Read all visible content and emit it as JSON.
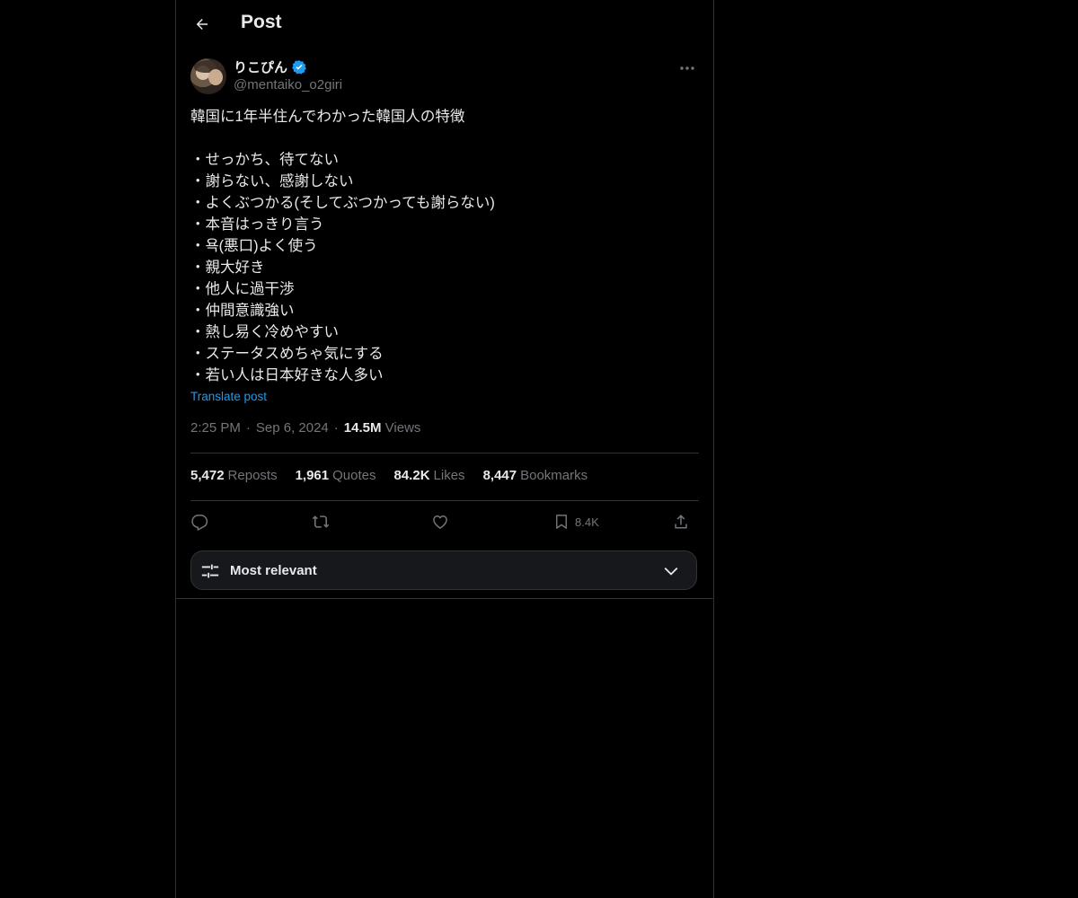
{
  "header": {
    "title": "Post"
  },
  "author": {
    "display_name": "りこぴん",
    "handle": "@mentaiko_o2giri"
  },
  "post": {
    "text": "韓国に1年半住んでわかった韓国人の特徴\n\n・せっかち、待てない\n・謝らない、感謝しない\n・よくぶつかる(そしてぶつかっても謝らない)\n・本音はっきり言う\n・욕(悪口)よく使う\n・親大好き\n・他人に過干渉\n・仲間意識強い\n・熱し易く冷めやすい\n・ステータスめちゃ気にする\n・若い人は日本好きな人多い",
    "translate_label": "Translate post",
    "time": "2:25 PM",
    "date": "Sep 6, 2024",
    "separator": "·",
    "views_count": "14.5M",
    "views_label": "Views"
  },
  "stats": [
    {
      "count": "5,472",
      "label": "Reposts"
    },
    {
      "count": "1,961",
      "label": "Quotes"
    },
    {
      "count": "84.2K",
      "label": "Likes"
    },
    {
      "count": "8,447",
      "label": "Bookmarks"
    }
  ],
  "actions": {
    "bookmark_count": "8.4K"
  },
  "sort": {
    "label": "Most relevant"
  },
  "icons": {
    "back": "arrow-left-icon",
    "verified": "verified-badge-icon",
    "more": "more-horizontal-icon",
    "reply": "reply-icon",
    "repost": "repost-icon",
    "like": "heart-icon",
    "bookmark": "bookmark-icon",
    "share": "share-icon",
    "sort": "sliders-icon",
    "chevron": "chevron-down-icon"
  },
  "colors": {
    "background": "#000000",
    "text": "#e7e9ea",
    "muted": "#71767b",
    "accent": "#1d9bf0",
    "border": "#2f3336"
  }
}
